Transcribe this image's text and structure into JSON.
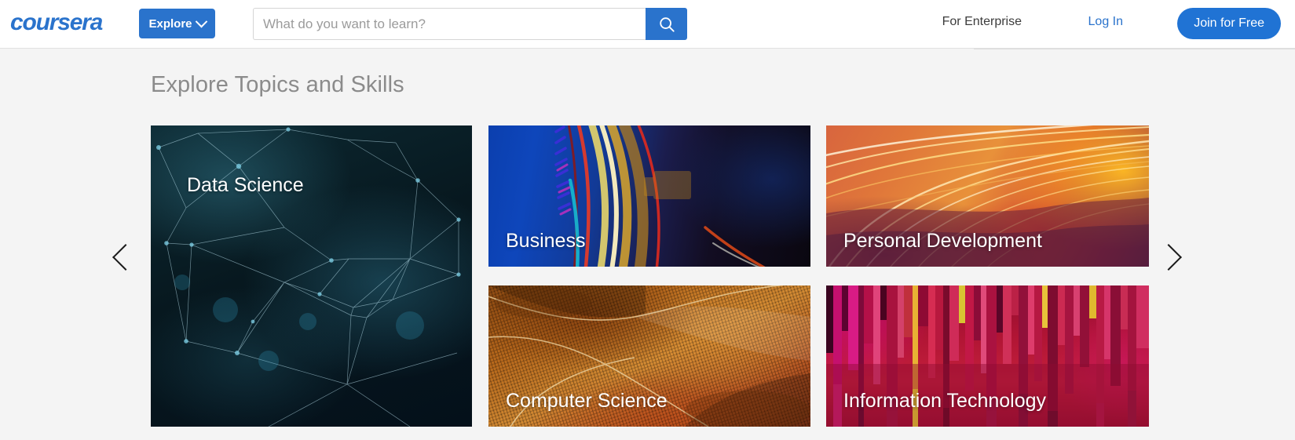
{
  "header": {
    "logo_text": "coursera",
    "logo_icon": "coursera-wordmark-logo",
    "explore_label": "Explore",
    "explore_chevron_icon": "chevron-down-icon",
    "search": {
      "placeholder": "What do you want to learn?",
      "value": "",
      "button_icon": "search-icon"
    },
    "enterprise_label": "For Enterprise",
    "login_label": "Log In",
    "join_label": "Join for Free",
    "colors": {
      "brand_blue": "#2a73cc",
      "join_blue": "#2073d4",
      "link_blue": "#2a73cc",
      "text_dark": "#3c3c3c",
      "border": "#e1e1e1"
    }
  },
  "main": {
    "section_title": "Explore Topics and Skills",
    "prev_arrow_icon": "chevron-left-icon",
    "next_arrow_icon": "chevron-right-icon",
    "cards": [
      {
        "label": "Data Science",
        "art": "network-nodes-dark-teal"
      },
      {
        "label": "Business",
        "art": "blue-light-streak-arcs"
      },
      {
        "label": "Personal Development",
        "art": "orange-sunset-curves"
      },
      {
        "label": "Computer Science",
        "art": "amber-woven-mesh"
      },
      {
        "label": "Information Technology",
        "art": "magenta-vertical-bars"
      }
    ],
    "colors": {
      "page_background": "#f4f4f4",
      "section_title": "#8b8b8b",
      "card_label": "#ffffff"
    }
  }
}
